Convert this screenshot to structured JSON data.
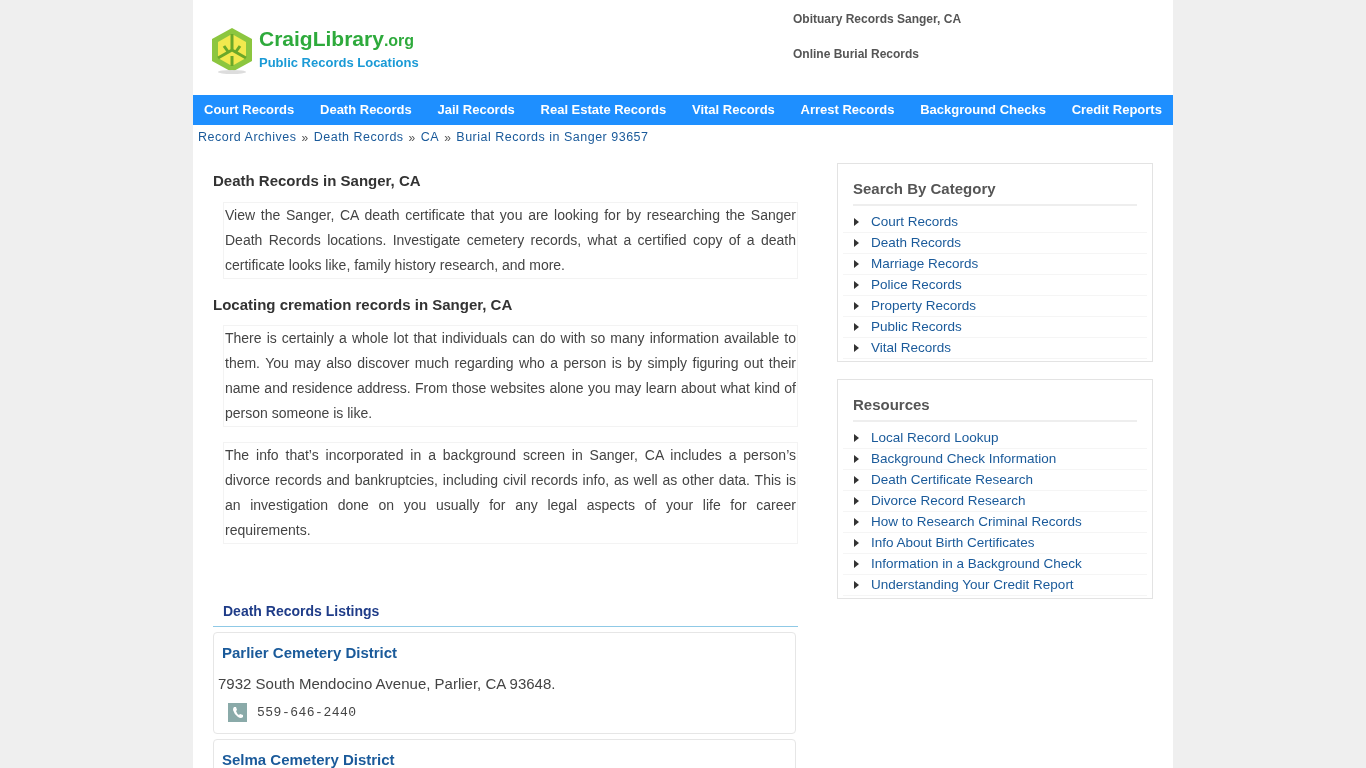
{
  "logo": {
    "name": "CraigLibrary",
    "tld": ".org",
    "tagline": "Public Records Locations"
  },
  "header_links": [
    "Obituary Records Sanger, CA",
    "Online Burial Records"
  ],
  "nav": [
    "Court Records",
    "Death Records",
    "Jail Records",
    "Real Estate Records",
    "Vital Records",
    "Arrest Records",
    "Background Checks",
    "Credit Reports"
  ],
  "breadcrumb": {
    "separator": "»",
    "items": [
      "Record Archives",
      "Death Records",
      "CA",
      "Burial Records in Sanger 93657"
    ]
  },
  "sections": [
    {
      "heading": "Death Records in Sanger, CA",
      "paragraphs": [
        "View the Sanger, CA death certificate that you are looking for by researching the Sanger Death Records locations. Investigate cemetery records, what a certified copy of a death certificate looks like, family history research, and more."
      ]
    },
    {
      "heading": "Locating cremation records in Sanger, CA",
      "paragraphs": [
        "There is certainly a whole lot that individuals can do with so many information available to them. You may also discover much regarding who a person is by simply figuring out their name and residence address. From those websites alone you may learn about what kind of person someone is like.",
        "The info that’s incorporated in a background screen in Sanger, CA includes a person’s divorce records and bankruptcies, including civil records info, as well as other data. This is an investigation done on you usually for any legal aspects of your life for career requirements."
      ]
    }
  ],
  "listings": {
    "title": "Death Records Listings",
    "items": [
      {
        "name": "Parlier Cemetery District",
        "address": "7932 South Mendocino Avenue, Parlier, CA 93648.",
        "phone": "559-646-2440"
      },
      {
        "name": "Selma Cemetery District"
      }
    ]
  },
  "sidebar": [
    {
      "title": "Search By Category",
      "items": [
        "Court Records",
        "Death Records",
        "Marriage Records",
        "Police Records",
        "Property Records",
        "Public Records",
        "Vital Records"
      ]
    },
    {
      "title": "Resources",
      "items": [
        "Local Record Lookup",
        "Background Check Information",
        "Death Certificate Research",
        "Divorce Record Research",
        "How to Research Criminal Records",
        "Info About Birth Certificates",
        "Information in a Background Check",
        "Understanding Your Credit Report"
      ]
    }
  ]
}
